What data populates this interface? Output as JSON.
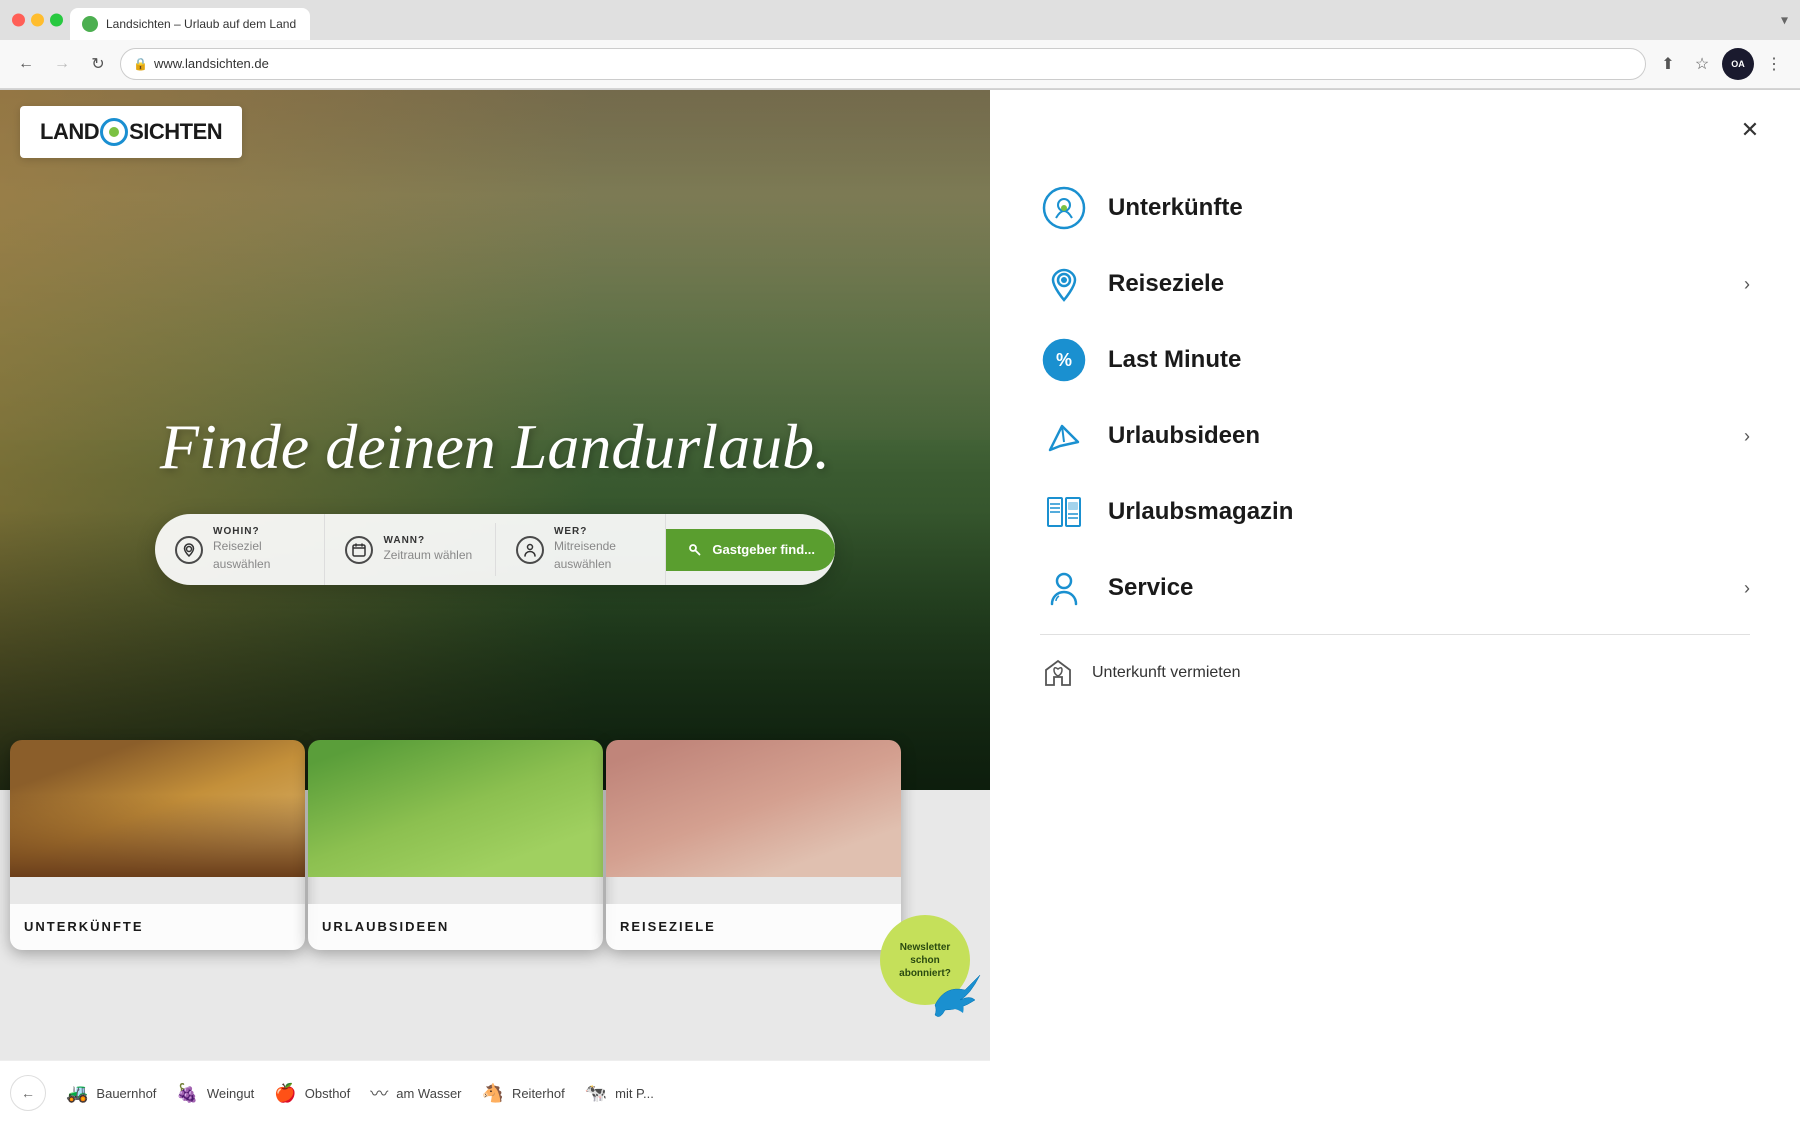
{
  "browser": {
    "tab": {
      "title": "Landsichten – Urlaub auf dem Land",
      "favicon": "L"
    },
    "address": "www.landsichten.de",
    "dropdown_icon": "▾",
    "close_icon": "✕"
  },
  "logo": {
    "part1": "LAND",
    "part2": "SICHTEN"
  },
  "hero": {
    "title": "Finde deinen Landurlaub.",
    "search": {
      "field1_label": "WOHIN?",
      "field1_hint": "Reiseziel auswählen",
      "field2_label": "WANN?",
      "field2_hint": "Zeitraum wählen",
      "field3_label": "WER?",
      "field3_hint": "Mitreisende auswählen",
      "button_text": "Gastgeber find..."
    }
  },
  "cards": [
    {
      "label": "UNTERKÜNFTE",
      "bg_class": "card-bg-1"
    },
    {
      "label": "URLAUBSIDEEN",
      "bg_class": "card-bg-2"
    },
    {
      "label": "REISEZIELE",
      "bg_class": "card-bg-3"
    }
  ],
  "bottom_nav": [
    {
      "icon": "🚜",
      "label": "Bauernhof"
    },
    {
      "icon": "🍇",
      "label": "Weingut"
    },
    {
      "icon": "🍎",
      "label": "Obsthof"
    },
    {
      "icon": "🌊",
      "label": "am Wasser"
    },
    {
      "icon": "🐴",
      "label": "Reiterhof"
    },
    {
      "icon": "🐄",
      "label": "mit P..."
    }
  ],
  "newsletter": {
    "text": "Newsletter schon abonniert?"
  },
  "sidebar": {
    "close_label": "×",
    "items": [
      {
        "id": "unterkunfte",
        "label": "Unterkünfte",
        "has_chevron": false,
        "icon_type": "location-search"
      },
      {
        "id": "reiseziele",
        "label": "Reiseziele",
        "has_chevron": true,
        "icon_type": "pin-map"
      },
      {
        "id": "last-minute",
        "label": "Last Minute",
        "has_chevron": false,
        "icon_type": "percent-badge"
      },
      {
        "id": "urlaubsideen",
        "label": "Urlaubsideen",
        "has_chevron": true,
        "icon_type": "paper-plane"
      },
      {
        "id": "urlaubsmagazin",
        "label": "Urlaubsmagazin",
        "has_chevron": false,
        "icon_type": "newspaper"
      },
      {
        "id": "service",
        "label": "Service",
        "has_chevron": true,
        "icon_type": "person-support"
      }
    ],
    "sub_item": {
      "label": "Unterkunft vermieten",
      "icon_type": "house-heart"
    }
  }
}
